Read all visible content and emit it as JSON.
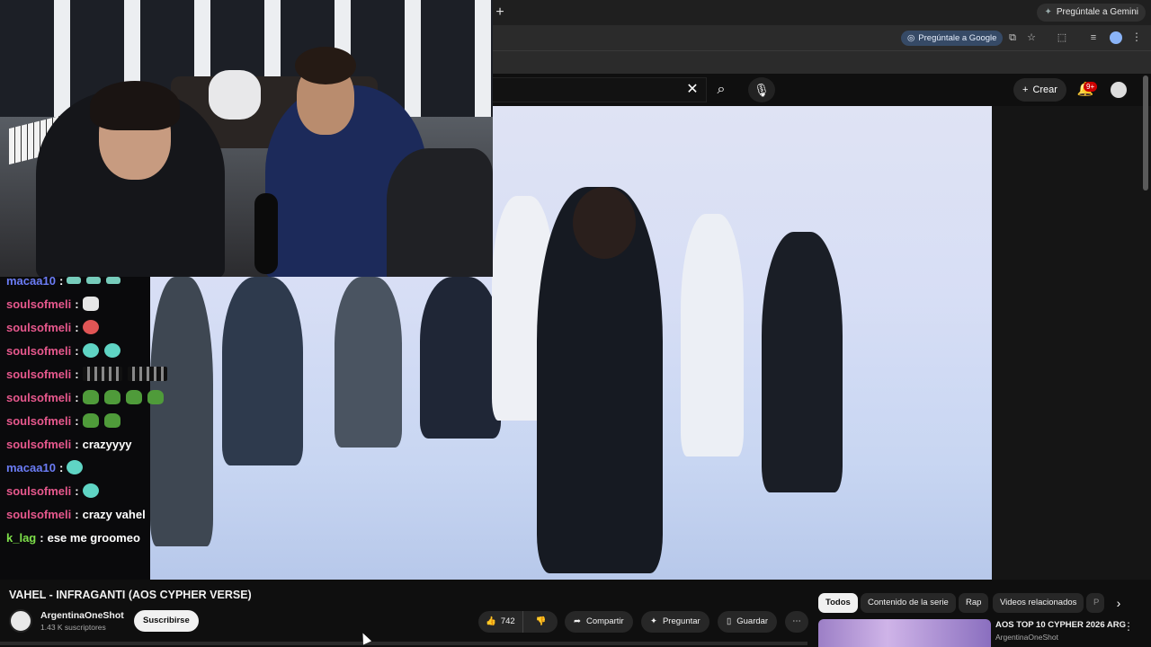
{
  "browser": {
    "gemini_label": "Pregúntale a Gemini",
    "ask_google_label": "Pregúntale a Google",
    "new_tab_glyph": "+"
  },
  "header": {
    "create_label": "Crear",
    "notif_badge": "9+"
  },
  "chat": {
    "lines": [
      {
        "user": "macaa10",
        "msg": "",
        "color": "blue"
      },
      {
        "user": "soulsofmeli",
        "msg": ""
      },
      {
        "user": "soulsofmeli",
        "msg": ""
      },
      {
        "user": "soulsofmeli",
        "msg": ""
      },
      {
        "user": "soulsofmeli",
        "msg": ""
      },
      {
        "user": "soulsofmeli",
        "msg": ""
      },
      {
        "user": "soulsofmeli",
        "msg": ""
      },
      {
        "user": "soulsofmeli",
        "msg": "crazyyyy"
      },
      {
        "user": "macaa10",
        "msg": "",
        "color": "blue"
      },
      {
        "user": "soulsofmeli",
        "msg": ""
      },
      {
        "user": "soulsofmeli",
        "msg": "crazy vahel"
      },
      {
        "user": "k_lag",
        "msg": "ese me groomeo",
        "color": "green"
      }
    ],
    "separator": ":"
  },
  "video": {
    "title": "VAHEL - INFRAGANTI (AOS CYPHER VERSE)",
    "channel_name": "ArgentinaOneShot",
    "subscribers": "1.43 K suscriptores",
    "subscribe_label": "Suscribirse",
    "likes": "742",
    "share_label": "Compartir",
    "ask_label": "Preguntar",
    "save_label": "Guardar"
  },
  "chips": [
    "Todos",
    "Contenido de la serie",
    "Rap",
    "Videos relacionados",
    "P"
  ],
  "recommendation": {
    "title": "AOS TOP 10 CYPHER 2026 ARG",
    "channel": "ArgentinaOneShot"
  },
  "colors": {
    "chat_user": "#e7588d",
    "chat_user_blue": "#6b7cf5",
    "chat_user_green": "#7ee04a",
    "notif_red": "#cc0000"
  }
}
